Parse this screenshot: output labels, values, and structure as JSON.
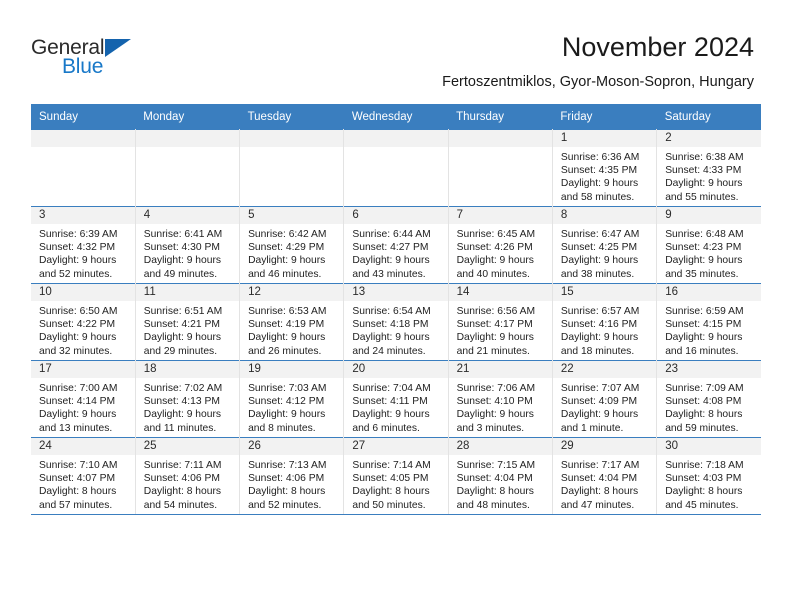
{
  "brand": {
    "name_part1": "General",
    "name_part2": "Blue",
    "accent_color": "#1878c8",
    "triangle_color": "#1463ad"
  },
  "header": {
    "title": "November 2024",
    "subtitle": "Fertoszentmiklos, Gyor-Moson-Sopron, Hungary",
    "header_bar_color": "#3a7ebf"
  },
  "weekdays": [
    "Sunday",
    "Monday",
    "Tuesday",
    "Wednesday",
    "Thursday",
    "Friday",
    "Saturday"
  ],
  "weeks": [
    [
      {
        "day": "",
        "lines": []
      },
      {
        "day": "",
        "lines": []
      },
      {
        "day": "",
        "lines": []
      },
      {
        "day": "",
        "lines": []
      },
      {
        "day": "",
        "lines": []
      },
      {
        "day": "1",
        "lines": [
          "Sunrise: 6:36 AM",
          "Sunset: 4:35 PM",
          "Daylight: 9 hours",
          "and 58 minutes."
        ]
      },
      {
        "day": "2",
        "lines": [
          "Sunrise: 6:38 AM",
          "Sunset: 4:33 PM",
          "Daylight: 9 hours",
          "and 55 minutes."
        ]
      }
    ],
    [
      {
        "day": "3",
        "lines": [
          "Sunrise: 6:39 AM",
          "Sunset: 4:32 PM",
          "Daylight: 9 hours",
          "and 52 minutes."
        ]
      },
      {
        "day": "4",
        "lines": [
          "Sunrise: 6:41 AM",
          "Sunset: 4:30 PM",
          "Daylight: 9 hours",
          "and 49 minutes."
        ]
      },
      {
        "day": "5",
        "lines": [
          "Sunrise: 6:42 AM",
          "Sunset: 4:29 PM",
          "Daylight: 9 hours",
          "and 46 minutes."
        ]
      },
      {
        "day": "6",
        "lines": [
          "Sunrise: 6:44 AM",
          "Sunset: 4:27 PM",
          "Daylight: 9 hours",
          "and 43 minutes."
        ]
      },
      {
        "day": "7",
        "lines": [
          "Sunrise: 6:45 AM",
          "Sunset: 4:26 PM",
          "Daylight: 9 hours",
          "and 40 minutes."
        ]
      },
      {
        "day": "8",
        "lines": [
          "Sunrise: 6:47 AM",
          "Sunset: 4:25 PM",
          "Daylight: 9 hours",
          "and 38 minutes."
        ]
      },
      {
        "day": "9",
        "lines": [
          "Sunrise: 6:48 AM",
          "Sunset: 4:23 PM",
          "Daylight: 9 hours",
          "and 35 minutes."
        ]
      }
    ],
    [
      {
        "day": "10",
        "lines": [
          "Sunrise: 6:50 AM",
          "Sunset: 4:22 PM",
          "Daylight: 9 hours",
          "and 32 minutes."
        ]
      },
      {
        "day": "11",
        "lines": [
          "Sunrise: 6:51 AM",
          "Sunset: 4:21 PM",
          "Daylight: 9 hours",
          "and 29 minutes."
        ]
      },
      {
        "day": "12",
        "lines": [
          "Sunrise: 6:53 AM",
          "Sunset: 4:19 PM",
          "Daylight: 9 hours",
          "and 26 minutes."
        ]
      },
      {
        "day": "13",
        "lines": [
          "Sunrise: 6:54 AM",
          "Sunset: 4:18 PM",
          "Daylight: 9 hours",
          "and 24 minutes."
        ]
      },
      {
        "day": "14",
        "lines": [
          "Sunrise: 6:56 AM",
          "Sunset: 4:17 PM",
          "Daylight: 9 hours",
          "and 21 minutes."
        ]
      },
      {
        "day": "15",
        "lines": [
          "Sunrise: 6:57 AM",
          "Sunset: 4:16 PM",
          "Daylight: 9 hours",
          "and 18 minutes."
        ]
      },
      {
        "day": "16",
        "lines": [
          "Sunrise: 6:59 AM",
          "Sunset: 4:15 PM",
          "Daylight: 9 hours",
          "and 16 minutes."
        ]
      }
    ],
    [
      {
        "day": "17",
        "lines": [
          "Sunrise: 7:00 AM",
          "Sunset: 4:14 PM",
          "Daylight: 9 hours",
          "and 13 minutes."
        ]
      },
      {
        "day": "18",
        "lines": [
          "Sunrise: 7:02 AM",
          "Sunset: 4:13 PM",
          "Daylight: 9 hours",
          "and 11 minutes."
        ]
      },
      {
        "day": "19",
        "lines": [
          "Sunrise: 7:03 AM",
          "Sunset: 4:12 PM",
          "Daylight: 9 hours",
          "and 8 minutes."
        ]
      },
      {
        "day": "20",
        "lines": [
          "Sunrise: 7:04 AM",
          "Sunset: 4:11 PM",
          "Daylight: 9 hours",
          "and 6 minutes."
        ]
      },
      {
        "day": "21",
        "lines": [
          "Sunrise: 7:06 AM",
          "Sunset: 4:10 PM",
          "Daylight: 9 hours",
          "and 3 minutes."
        ]
      },
      {
        "day": "22",
        "lines": [
          "Sunrise: 7:07 AM",
          "Sunset: 4:09 PM",
          "Daylight: 9 hours",
          "and 1 minute."
        ]
      },
      {
        "day": "23",
        "lines": [
          "Sunrise: 7:09 AM",
          "Sunset: 4:08 PM",
          "Daylight: 8 hours",
          "and 59 minutes."
        ]
      }
    ],
    [
      {
        "day": "24",
        "lines": [
          "Sunrise: 7:10 AM",
          "Sunset: 4:07 PM",
          "Daylight: 8 hours",
          "and 57 minutes."
        ]
      },
      {
        "day": "25",
        "lines": [
          "Sunrise: 7:11 AM",
          "Sunset: 4:06 PM",
          "Daylight: 8 hours",
          "and 54 minutes."
        ]
      },
      {
        "day": "26",
        "lines": [
          "Sunrise: 7:13 AM",
          "Sunset: 4:06 PM",
          "Daylight: 8 hours",
          "and 52 minutes."
        ]
      },
      {
        "day": "27",
        "lines": [
          "Sunrise: 7:14 AM",
          "Sunset: 4:05 PM",
          "Daylight: 8 hours",
          "and 50 minutes."
        ]
      },
      {
        "day": "28",
        "lines": [
          "Sunrise: 7:15 AM",
          "Sunset: 4:04 PM",
          "Daylight: 8 hours",
          "and 48 minutes."
        ]
      },
      {
        "day": "29",
        "lines": [
          "Sunrise: 7:17 AM",
          "Sunset: 4:04 PM",
          "Daylight: 8 hours",
          "and 47 minutes."
        ]
      },
      {
        "day": "30",
        "lines": [
          "Sunrise: 7:18 AM",
          "Sunset: 4:03 PM",
          "Daylight: 8 hours",
          "and 45 minutes."
        ]
      }
    ]
  ]
}
